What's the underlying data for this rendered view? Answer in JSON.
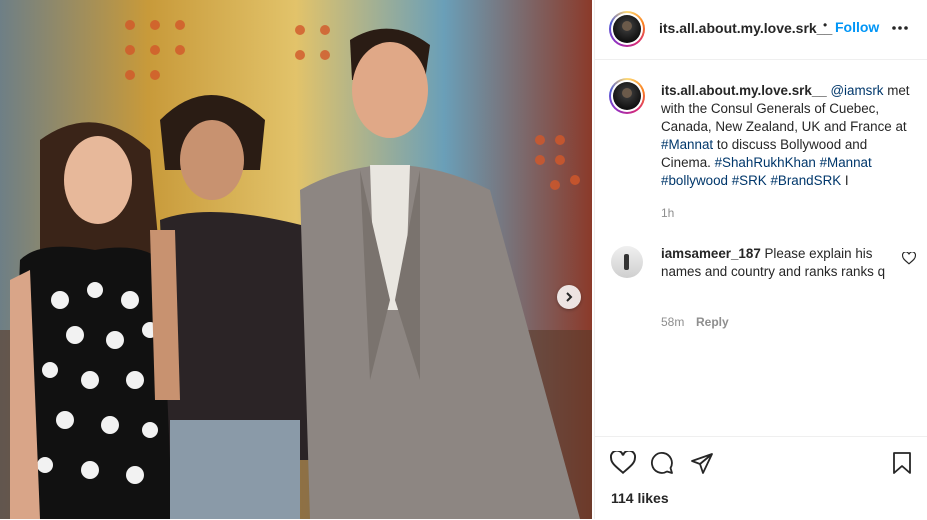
{
  "post": {
    "author": "its.all.about.my.love.srk__",
    "follow_label": "Follow",
    "separator": "•",
    "more_label": "•••"
  },
  "caption": {
    "author": "its.all.about.my.love.srk__",
    "mention": "@iamsrk",
    "text_1": " met with the Consul Generals of Cuebec, Canada, New Zealand, UK and France at ",
    "tag_mannat": "#Mannat",
    "text_2": " to discuss Bollywood and Cinema. ",
    "tag_srk": "#ShahRukhKhan",
    "tag_mannat2": "#Mannat",
    "tag_bollywood": "#bollywood",
    "tag_srk2": "#SRK",
    "tag_brand": "#BrandSRK",
    "trail": " I",
    "time": "1h"
  },
  "comments": [
    {
      "user": "iamsameer_187",
      "text": " Please explain his names and country and ranks ranks q",
      "time": "58m",
      "reply_label": "Reply"
    }
  ],
  "footer": {
    "likes": "114 likes"
  },
  "colors": {
    "link": "#00376b",
    "follow": "#0095f6",
    "muted": "#8e8e8e"
  },
  "icons": [
    "chevron-right-icon",
    "more-icon",
    "heart-icon",
    "comment-icon",
    "share-icon",
    "bookmark-icon"
  ]
}
